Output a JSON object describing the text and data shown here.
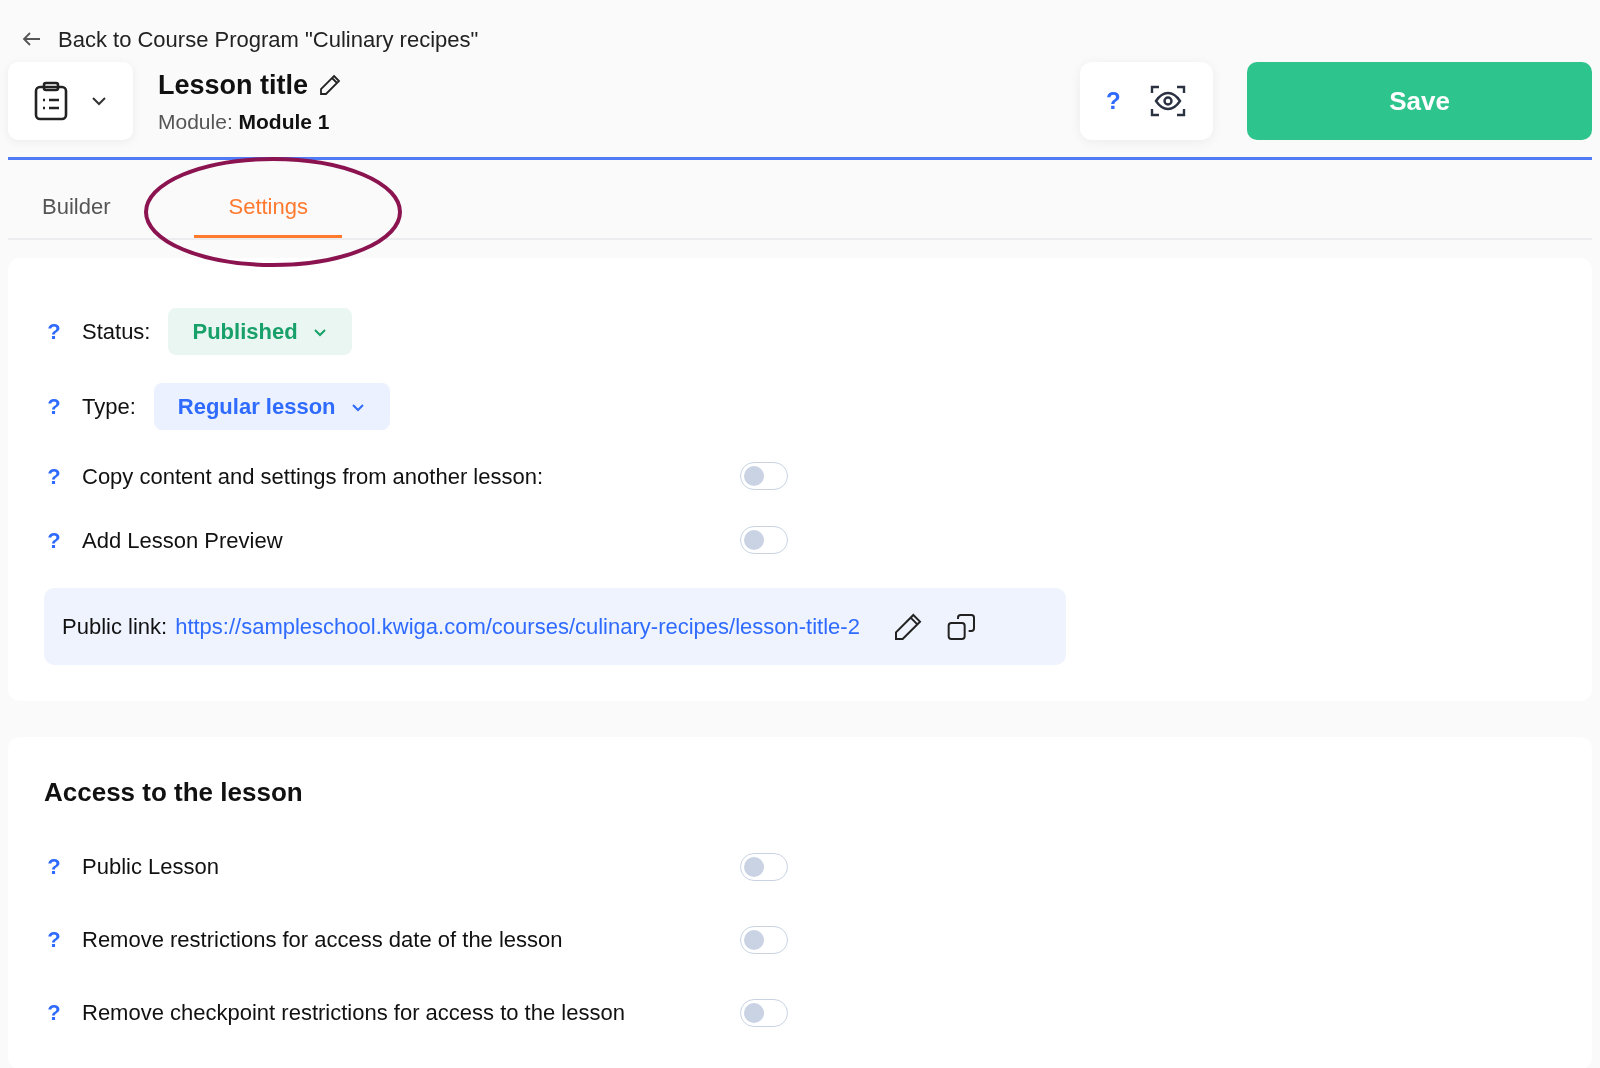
{
  "back_link": "Back to Course Program \"Culinary recipes\"",
  "header": {
    "title": "Lesson title",
    "module": "Module: **Module 1**",
    "help": "?",
    "save": "Save"
  },
  "tabs": [
    {
      "label": "Builder",
      "selected": false,
      "circled": false
    },
    {
      "label": "Settings",
      "selected": true,
      "circled": true
    }
  ],
  "settings": [
    {
      "kind": "select",
      "help": "?",
      "label": "Status:",
      "value": "Published",
      "color": "#17a06a"
    },
    {
      "kind": "select",
      "help": "?",
      "label": "Type:",
      "value": "Regular lesson",
      "color": "#2f6bff"
    },
    {
      "kind": "toggle",
      "help": "?",
      "label": "Copy content and settings from another lesson:",
      "on": false
    },
    {
      "kind": "toggle",
      "help": "?",
      "label": "Add Lesson Preview",
      "on": false
    }
  ],
  "public_link": {
    "label": "Public link:",
    "url": "https://sampleschool.kwiga.com/courses/culinary-recipes/lesson-title-2"
  },
  "access": {
    "title": "Access to the lesson",
    "items": [
      {
        "help": "?",
        "label": "Public Lesson",
        "on": false
      },
      {
        "help": "?",
        "label": "Remove restrictions for access date of the lesson",
        "on": false
      },
      {
        "help": "?",
        "label": "Remove checkpoint restrictions for access to the lesson",
        "on": false
      }
    ]
  }
}
